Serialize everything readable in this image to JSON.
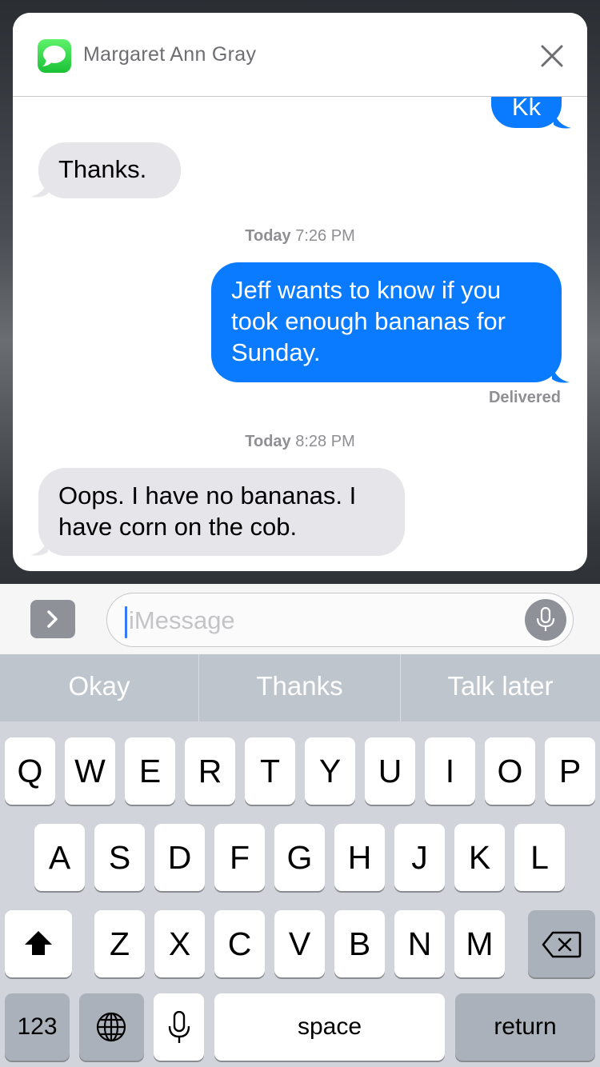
{
  "notification": {
    "app_icon": "messages-icon",
    "contact_name": "Margaret Ann Gray",
    "close_icon": "close-icon"
  },
  "thread": {
    "partial_outgoing": "Kk",
    "msg_thanks": "Thanks.",
    "stamp1_day": "Today",
    "stamp1_time": "7:26 PM",
    "msg_jeff_line1": "Jeff wants to know if you",
    "msg_jeff_line2": "took enough bananas for",
    "msg_jeff_line3": "Sunday.",
    "delivered": "Delivered",
    "stamp2_day": "Today",
    "stamp2_time": "8:28 PM",
    "msg_oops_line1": "Oops. I have no bananas. I",
    "msg_oops_line2": "have corn on the cob."
  },
  "input_bar": {
    "placeholder": "iMessage",
    "expand_icon": "chevron-right-icon",
    "dictation_icon": "microphone-icon"
  },
  "predictive": {
    "s1": "Okay",
    "s2": "Thanks",
    "s3": "Talk later"
  },
  "keyboard": {
    "row1": [
      "Q",
      "W",
      "E",
      "R",
      "T",
      "Y",
      "U",
      "I",
      "O",
      "P"
    ],
    "row2": [
      "A",
      "S",
      "D",
      "F",
      "G",
      "H",
      "J",
      "K",
      "L"
    ],
    "row3": [
      "Z",
      "X",
      "C",
      "V",
      "B",
      "N",
      "M"
    ],
    "shift_icon": "shift-icon",
    "delete_icon": "backspace-icon",
    "numbers": "123",
    "globe_icon": "globe-icon",
    "mic_icon": "microphone-icon",
    "space": "space",
    "return": "return"
  },
  "colors": {
    "outgoing_bubble": "#0a7aff",
    "incoming_bubble": "#e5e5ea",
    "messages_green": "#1bc236"
  }
}
